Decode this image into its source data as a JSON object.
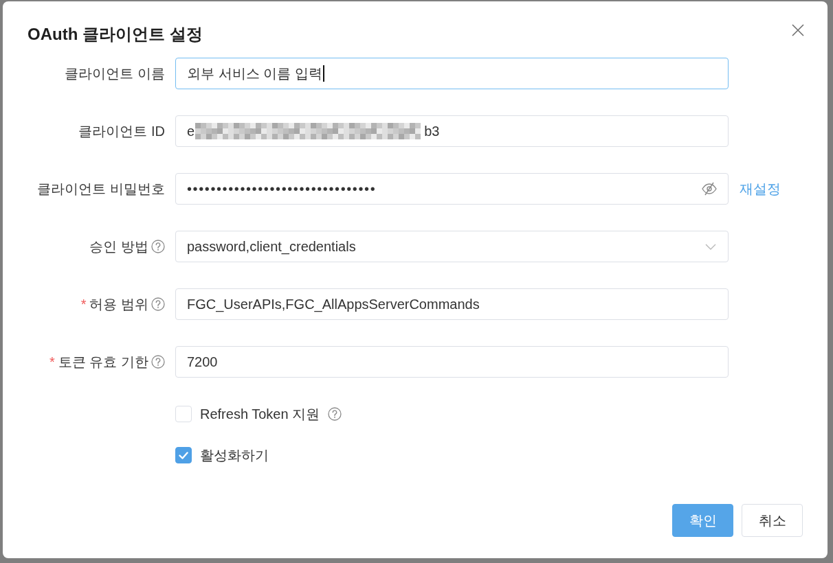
{
  "dialog": {
    "title": "OAuth 클라이언트 설정"
  },
  "fields": [
    {
      "kind": "text",
      "label": "클라이언트 이름",
      "help": false,
      "focused": true,
      "value": "외부 서비스 이름 입력"
    },
    {
      "kind": "redacted",
      "label": "클라이언트 ID",
      "help": false,
      "focused": false,
      "value_start": "e",
      "value_end": "b3"
    },
    {
      "kind": "secret",
      "label": "클라이언트 비밀번호",
      "help": false,
      "focused": false,
      "visible": false,
      "value": "••••••••••••••••••••••••••••••••",
      "action": "재설정"
    },
    {
      "kind": "select",
      "label": "승인 방법",
      "help": true,
      "focused": false,
      "value": "password,client_credentials"
    },
    {
      "kind": "text",
      "label": "허용 범위",
      "required_mark": "*",
      "help": true,
      "focused": false,
      "value": "FGC_UserAPIs,FGC_AllAppsServerCommands"
    },
    {
      "kind": "text",
      "label": "토큰 유효 기한",
      "required_mark": "*",
      "help": true,
      "focused": false,
      "value": "7200"
    }
  ],
  "checkboxes": [
    {
      "label": "Refresh Token 지원",
      "checked": false,
      "help": true
    },
    {
      "label": "활성화하기",
      "checked": true,
      "help": false
    }
  ],
  "buttons": [
    {
      "label": "확인",
      "kind": "primary"
    },
    {
      "label": "취소",
      "kind": "default"
    }
  ]
}
